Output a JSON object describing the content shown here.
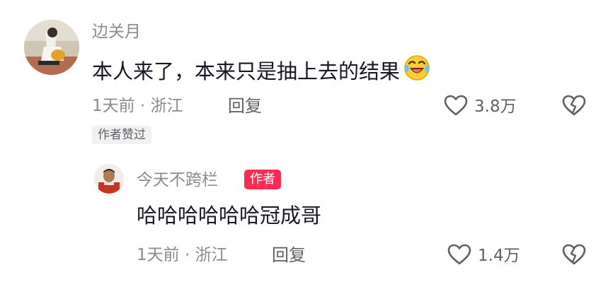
{
  "comment": {
    "username": "边关月",
    "text": "本人来了，本来只是抽上去的结果",
    "emoji": "rolling-on-floor-laughing-emoji",
    "time_location": "1天前 · 浙江",
    "reply_label": "回复",
    "like_count": "3.8万",
    "liked_by_author": "作者赞过"
  },
  "reply": {
    "username": "今天不跨栏",
    "author_tag": "作者",
    "text": "哈哈哈哈哈哈冠成哥",
    "time_location": "1天前 · 浙江",
    "reply_label": "回复",
    "like_count": "1.4万"
  },
  "colors": {
    "author_tag": "#fe2c55",
    "secondary_text": "#8a8b91",
    "primary_text": "#161823",
    "icon": "#5f6066"
  }
}
